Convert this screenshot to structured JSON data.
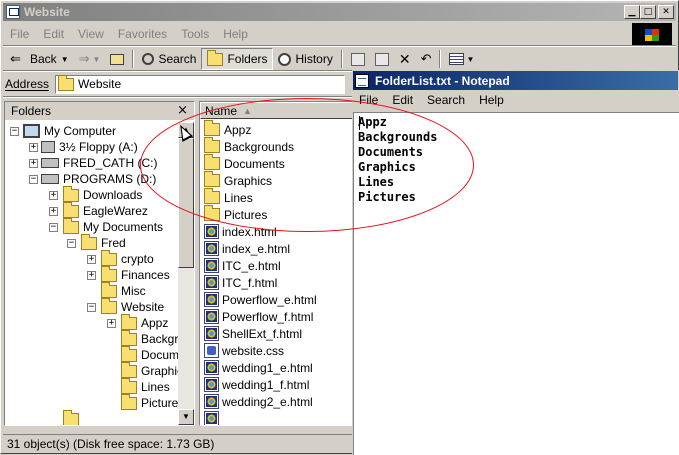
{
  "explorer": {
    "title": "Website",
    "menus": [
      "File",
      "Edit",
      "View",
      "Favorites",
      "Tools",
      "Help"
    ],
    "toolbar": {
      "back": "Back",
      "search": "Search",
      "folders": "Folders",
      "history": "History"
    },
    "address_label": "Address",
    "address_value": "Website",
    "folders_pane": {
      "title": "Folders",
      "close": "×",
      "tree": [
        {
          "label": "My Computer",
          "icon": "computer-icon",
          "expander": "−"
        },
        {
          "label": "3½ Floppy (A:)",
          "icon": "floppy-icon",
          "expander": "+"
        },
        {
          "label": "FRED_CATH (C:)",
          "icon": "drive-icon",
          "expander": "+"
        },
        {
          "label": "PROGRAMS (D:)",
          "icon": "drive-icon",
          "expander": "−"
        },
        {
          "label": "Downloads",
          "icon": "folder-icon",
          "expander": "+"
        },
        {
          "label": "EagleWarez",
          "icon": "folder-icon",
          "expander": "+"
        },
        {
          "label": "My Documents",
          "icon": "folder-icon",
          "expander": "−"
        },
        {
          "label": "Fred",
          "icon": "folder-icon",
          "expander": "−"
        },
        {
          "label": "crypto",
          "icon": "folder-icon",
          "expander": "+"
        },
        {
          "label": "Finances",
          "icon": "folder-icon",
          "expander": "+"
        },
        {
          "label": "Misc",
          "icon": "folder-icon",
          "expander": ""
        },
        {
          "label": "Website",
          "icon": "folder-icon",
          "expander": "−"
        },
        {
          "label": "Appz",
          "icon": "folder-icon",
          "expander": "+"
        },
        {
          "label": "Backgrounds",
          "icon": "folder-icon",
          "expander": ""
        },
        {
          "label": "Documents",
          "icon": "folder-icon",
          "expander": ""
        },
        {
          "label": "Graphics",
          "icon": "folder-icon",
          "expander": ""
        },
        {
          "label": "Lines",
          "icon": "folder-icon",
          "expander": ""
        },
        {
          "label": "Pictures",
          "icon": "folder-icon",
          "expander": ""
        }
      ]
    },
    "file_list": {
      "column_name": "Name",
      "items": [
        {
          "name": "Appz",
          "type": "folder"
        },
        {
          "name": "Backgrounds",
          "type": "folder"
        },
        {
          "name": "Documents",
          "type": "folder"
        },
        {
          "name": "Graphics",
          "type": "folder"
        },
        {
          "name": "Lines",
          "type": "folder"
        },
        {
          "name": "Pictures",
          "type": "folder"
        },
        {
          "name": "index.html",
          "type": "html"
        },
        {
          "name": "index_e.html",
          "type": "html"
        },
        {
          "name": "ITC_e.html",
          "type": "html"
        },
        {
          "name": "ITC_f.html",
          "type": "html"
        },
        {
          "name": "Powerflow_e.html",
          "type": "html"
        },
        {
          "name": "Powerflow_f.html",
          "type": "html"
        },
        {
          "name": "ShellExt_f.html",
          "type": "html"
        },
        {
          "name": "website.css",
          "type": "css"
        },
        {
          "name": "wedding1_e.html",
          "type": "html"
        },
        {
          "name": "wedding1_f.html",
          "type": "html"
        },
        {
          "name": "wedding2_e.html",
          "type": "html"
        }
      ]
    },
    "status": "31 object(s) (Disk free space: 1.73 GB)"
  },
  "notepad": {
    "title": "FolderList.txt - Notepad",
    "menus": [
      "File",
      "Edit",
      "Search",
      "Help"
    ],
    "lines": [
      "Appz",
      "Backgrounds",
      "Documents",
      "Graphics",
      "Lines",
      "Pictures"
    ]
  },
  "annotation_color": "#e8101a"
}
